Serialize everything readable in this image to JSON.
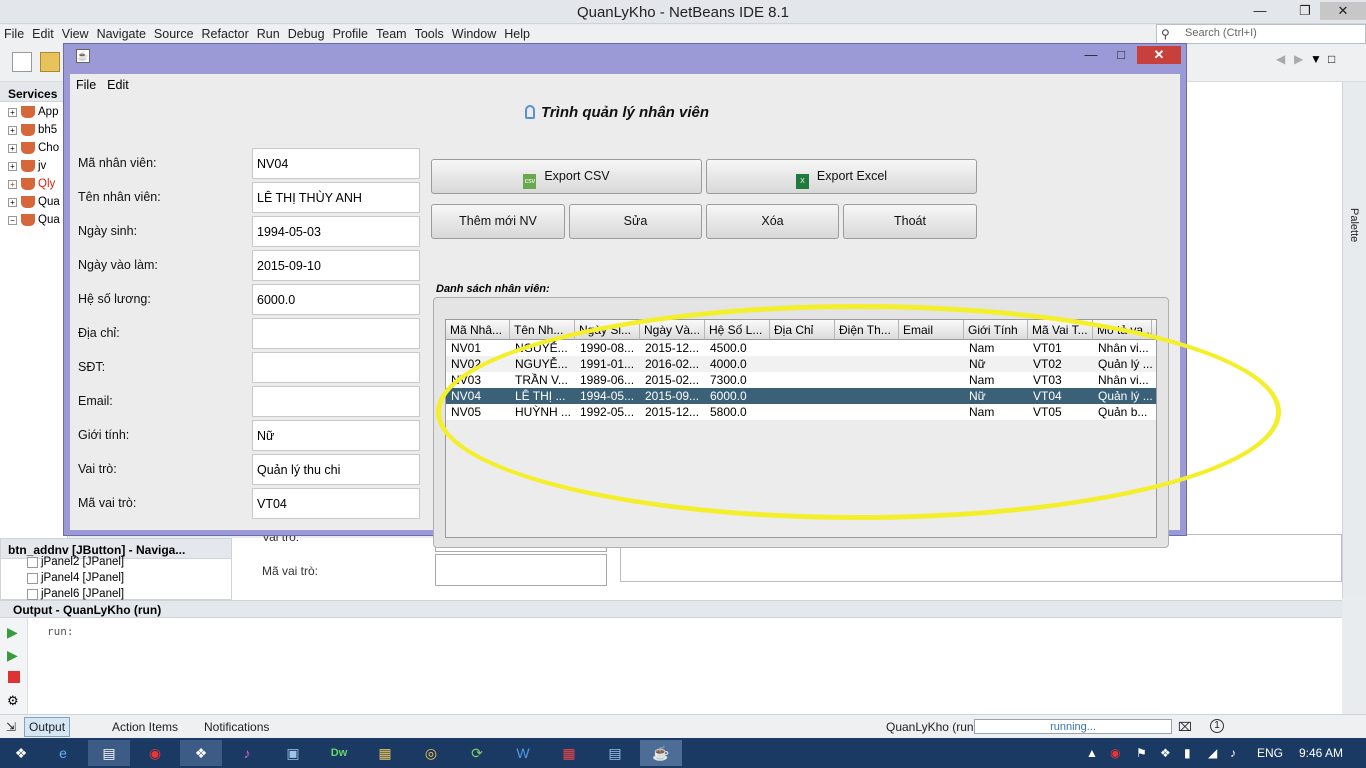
{
  "ide": {
    "title": "QuanLyKho - NetBeans IDE 8.1",
    "menu": [
      "File",
      "Edit",
      "View",
      "Navigate",
      "Source",
      "Refactor",
      "Run",
      "Debug",
      "Profile",
      "Team",
      "Tools",
      "Window",
      "Help"
    ],
    "search_placeholder": "Search (Ctrl+I)",
    "services_title": "Services",
    "services_items": [
      "App",
      "bh5",
      "Cho",
      "jv",
      "Qly",
      "Qua",
      "Qua"
    ],
    "palette_label": "Palette",
    "navigator_title": "btn_addnv [JButton] - Naviga...",
    "navigator_items": [
      "jPanel2 [JPanel]",
      "jPanel4 [JPanel]",
      "jPanel6 [JPanel]"
    ],
    "bg_form": {
      "label_role": "Vai trò:",
      "label_role_id": "Mã vai trò:"
    },
    "output_title": "Output - QuanLyKho (run)",
    "output_text": "run:",
    "status": {
      "output_tab": "Output",
      "action_items_tab": "Action Items",
      "notifications_tab": "Notifications",
      "project": "QuanLyKho (run)",
      "progress": "running...",
      "notification_count": "1"
    },
    "taskbar": {
      "lang": "ENG",
      "time": "9:46 AM"
    }
  },
  "dialog": {
    "menu": [
      "File",
      "Edit"
    ],
    "form_title": "Trình quản lý nhân viên",
    "fields": [
      {
        "label": "Mã nhân viên:",
        "value": "NV04"
      },
      {
        "label": "Tên nhân viên:",
        "value": "LÊ THỊ THÙY ANH"
      },
      {
        "label": "Ngày sinh:",
        "value": "1994-05-03"
      },
      {
        "label": "Ngày vào làm:",
        "value": "2015-09-10"
      },
      {
        "label": "Hệ số lương:",
        "value": "6000.0"
      },
      {
        "label": "Địa chỉ:",
        "value": ""
      },
      {
        "label": "SĐT:",
        "value": ""
      },
      {
        "label": "Email:",
        "value": ""
      },
      {
        "label": "Giới tính:",
        "value": "Nữ"
      },
      {
        "label": "Vai trò:",
        "value": "Quản lý thu chi"
      },
      {
        "label": "Mã vai trò:",
        "value": "VT04"
      }
    ],
    "buttons": {
      "export_csv": "Export CSV",
      "export_excel": "Export Excel",
      "add": "Thêm mới NV",
      "edit": "Sửa",
      "delete": "Xóa",
      "exit": "Thoát"
    },
    "list_title": "Danh sách nhân viên:",
    "table": {
      "headers": [
        "Mã Nhâ...",
        "Tên Nh...",
        "Ngày Si...",
        "Ngày Và...",
        "Hệ Số L...",
        "Địa Chỉ",
        "Điện Th...",
        "Email",
        "Giới Tính",
        "Mã Vai T...",
        "Mô tả va..."
      ],
      "rows": [
        [
          "NV01",
          "NGUYỄ...",
          "1990-08...",
          "2015-12...",
          "4500.0",
          "",
          "",
          "",
          "Nam",
          "VT01",
          "Nhân vi..."
        ],
        [
          "NV02",
          "NGUYỄ...",
          "1991-01...",
          "2016-02...",
          "4000.0",
          "",
          "",
          "",
          "Nữ",
          "VT02",
          "Quản lý ..."
        ],
        [
          "NV03",
          "TRẦN V...",
          "1989-06...",
          "2015-02...",
          "7300.0",
          "",
          "",
          "",
          "Nam",
          "VT03",
          "Nhân vi..."
        ],
        [
          "NV04",
          "LÊ THỊ ...",
          "1994-05...",
          "2015-09...",
          "6000.0",
          "",
          "",
          "",
          "Nữ",
          "VT04",
          "Quản lý ..."
        ],
        [
          "NV05",
          "HUỲNH ...",
          "1992-05...",
          "2015-12...",
          "5800.0",
          "",
          "",
          "",
          "Nam",
          "VT05",
          "Quản b..."
        ]
      ],
      "selected_row": 3
    }
  },
  "colors": {
    "dialog_frame": "#9b99d6",
    "selection": "#3a6178",
    "highlight_ellipse": "#f4ef2b",
    "close_button": "#c8403b"
  }
}
